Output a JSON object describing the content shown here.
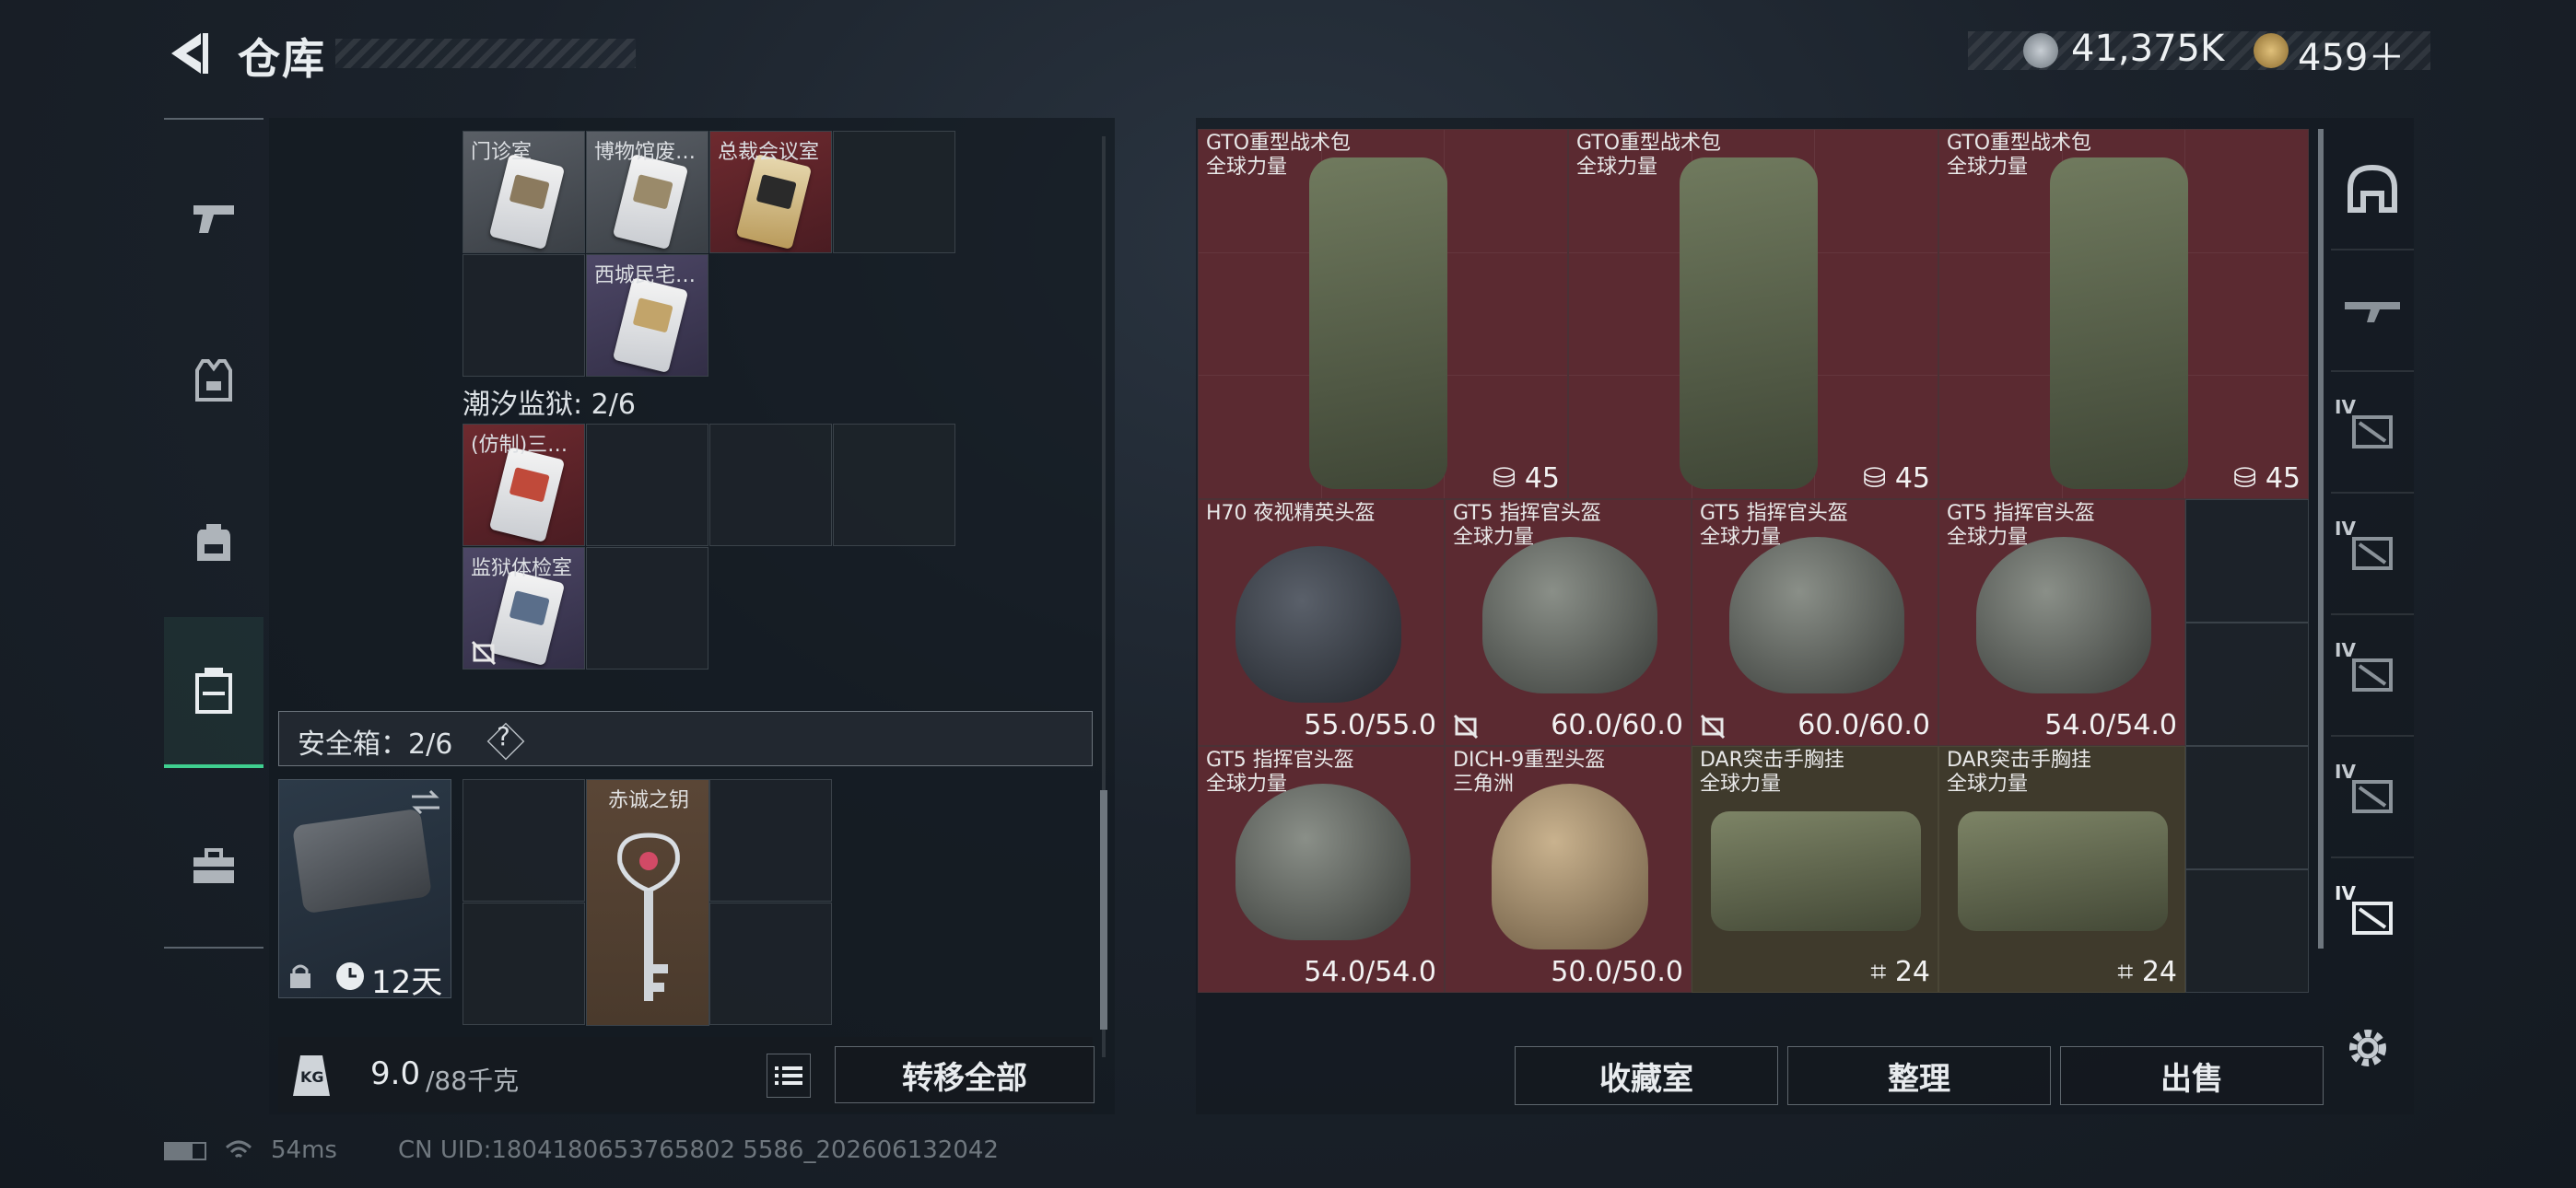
{
  "header": {
    "title": "仓库",
    "currency": [
      {
        "icon": "silver-coin-icon",
        "value": "41,375K",
        "color": "#8f9aa4"
      },
      {
        "icon": "gold-triangle-coin-icon",
        "value": "459＋",
        "color": "#c9a45a"
      }
    ]
  },
  "sidebar": {
    "items": [
      {
        "icon": "pistol-icon",
        "active": false
      },
      {
        "icon": "vest-icon",
        "active": false
      },
      {
        "icon": "backpack-icon",
        "active": false
      },
      {
        "icon": "keycard-case-icon",
        "active": true
      },
      {
        "icon": "toolbox-icon",
        "active": false
      }
    ]
  },
  "key_section_top": {
    "cells": [
      {
        "label": "门诊室",
        "color": "gray"
      },
      {
        "label": "博物馆废…",
        "color": "gray"
      },
      {
        "label": "总裁会议室",
        "color": "red"
      },
      {
        "label": "西城民宅…",
        "color": "purple"
      }
    ]
  },
  "prison_section": {
    "title": "潮汐监狱: 2/6",
    "cells": [
      {
        "label": "(仿制)三…",
        "color": "red"
      },
      {
        "label": "监狱体检室",
        "color": "purple"
      }
    ]
  },
  "safe_box": {
    "title": "安全箱：2/6",
    "help_label": "?",
    "duration": "12天",
    "key_label": "赤诚之钥"
  },
  "weight": {
    "value": "9.0",
    "capacity": "/88千克",
    "icon_label": "KG"
  },
  "buttons": {
    "transfer_all": "转移全部",
    "collection": "收藏室",
    "organize": "整理",
    "sell": "出售"
  },
  "items": [
    {
      "name": "GTO重型战术包",
      "sub": "全球力量",
      "value": "45",
      "kind": "backpack",
      "bg": "red"
    },
    {
      "name": "GTO重型战术包",
      "sub": "全球力量",
      "value": "45",
      "kind": "backpack",
      "bg": "red"
    },
    {
      "name": "GTO重型战术包",
      "sub": "全球力量",
      "value": "45",
      "kind": "backpack",
      "bg": "red"
    },
    {
      "name": "H70 夜视精英头盔",
      "sub": "",
      "value": "55.0/55.0",
      "kind": "nv-helmet",
      "bg": "red"
    },
    {
      "name": "GT5 指挥官头盔",
      "sub": "全球力量",
      "value": "60.0/60.0",
      "kind": "helmet",
      "bg": "red",
      "locked": true
    },
    {
      "name": "GT5 指挥官头盔",
      "sub": "全球力量",
      "value": "60.0/60.0",
      "kind": "helmet",
      "bg": "red",
      "locked": true
    },
    {
      "name": "GT5 指挥官头盔",
      "sub": "全球力量",
      "value": "54.0/54.0",
      "kind": "helmet",
      "bg": "red"
    },
    {
      "name": "GT5 指挥官头盔",
      "sub": "全球力量",
      "value": "54.0/54.0",
      "kind": "helmet",
      "bg": "red"
    },
    {
      "name": "DICH-9重型头盔",
      "sub": "三角洲",
      "value": "50.0/50.0",
      "kind": "tan-helmet",
      "bg": "red"
    },
    {
      "name": "DAR突击手胸挂",
      "sub": "全球力量",
      "value": "24",
      "kind": "chest-rig",
      "bg": "olive"
    },
    {
      "name": "DAR突击手胸挂",
      "sub": "全球力量",
      "value": "24",
      "kind": "chest-rig",
      "bg": "olive"
    }
  ],
  "right_sidebar": {
    "items": [
      {
        "icon": "helmet-filter-icon",
        "label": ""
      },
      {
        "icon": "rifle-filter-icon",
        "label": ""
      },
      {
        "icon": "armor-filter-icon",
        "label": "IV"
      },
      {
        "icon": "armor-filter-icon",
        "label": "IV"
      },
      {
        "icon": "armor-filter-icon",
        "label": "IV"
      },
      {
        "icon": "armor-filter-icon",
        "label": "IV"
      },
      {
        "icon": "armor-filter-icon",
        "label": "IV"
      }
    ]
  },
  "status_bar": {
    "ping": "54ms",
    "uid": "CN UID:1804180653765802 5586_202606132042"
  }
}
